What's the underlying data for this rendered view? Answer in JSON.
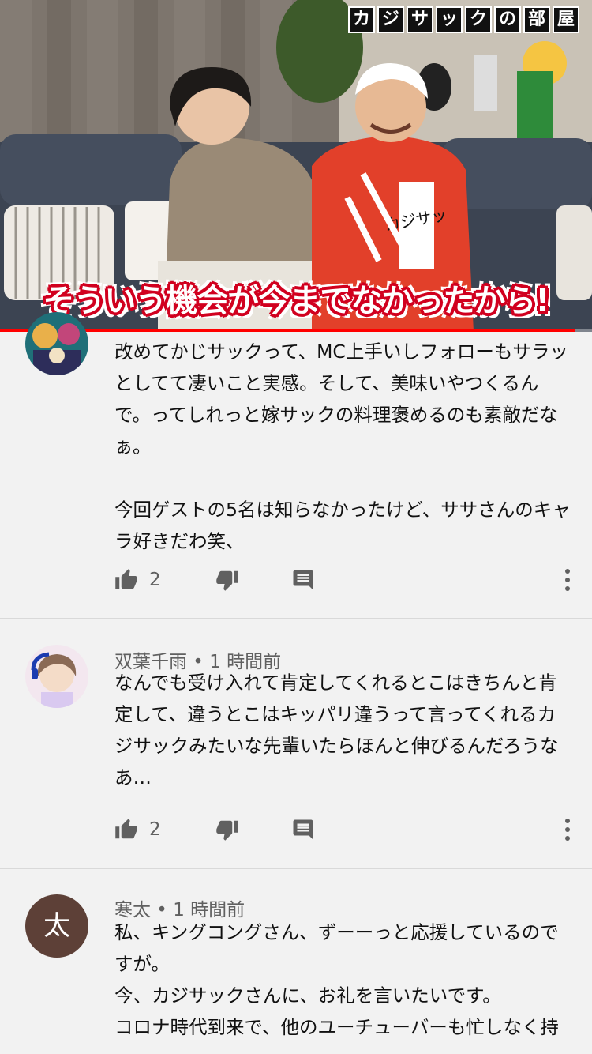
{
  "video": {
    "channel_badge_chars": [
      "カ",
      "ジ",
      "サ",
      "ッ",
      "ク",
      "の",
      "部",
      "屋"
    ],
    "caption": "そういう機会が今までなかったから!",
    "progress": 0.97,
    "shirt_label": "カジサッ"
  },
  "comments": [
    {
      "avatar_type": "image",
      "avatar_icon": "user-avatar-illustration",
      "author": "",
      "time": "",
      "paragraphs": [
        "改めてかじサックって、MC上手いしフォローもサラッとしてて凄いこと実感。そして、美味いやつくるんで。ってしれっと嫁サックの料理褒めるのも素敵だなぁ。",
        "今回ゲストの5名は知らなかったけど、ササさんのキャラ好きだわ笑、"
      ],
      "likes": "2"
    },
    {
      "avatar_type": "image",
      "avatar_icon": "user-avatar-anime",
      "author": "双葉千雨",
      "time": "1 時間前",
      "paragraphs": [
        "なんでも受け入れて肯定してくれるとこはきちんと肯定して、違うとこはキッパリ違うって言ってくれるカジサックみたいな先輩いたらほんと伸びるんだろうなあ…"
      ],
      "likes": "2"
    },
    {
      "avatar_type": "letter",
      "avatar_letter": "太",
      "author": "寒太",
      "time": "1 時間前",
      "paragraphs": [
        "私、キングコングさん、ずーーっと応援しているのですが。",
        "今、カジサックさんに、お礼を言いたいです。",
        "コロナ時代到来で、他のユーチューバーも忙しなく持"
      ],
      "likes": ""
    }
  ],
  "separator": " • ",
  "icons": {
    "like": "thumbs-up-icon",
    "dislike": "thumbs-down-icon",
    "reply": "reply-comment-icon",
    "more": "more-vertical-icon"
  },
  "colors": {
    "progress": "#ff0000",
    "caption_stroke": "#d1001f",
    "letter_avatar_bg": "#5d4037",
    "meta_text": "#606060"
  }
}
